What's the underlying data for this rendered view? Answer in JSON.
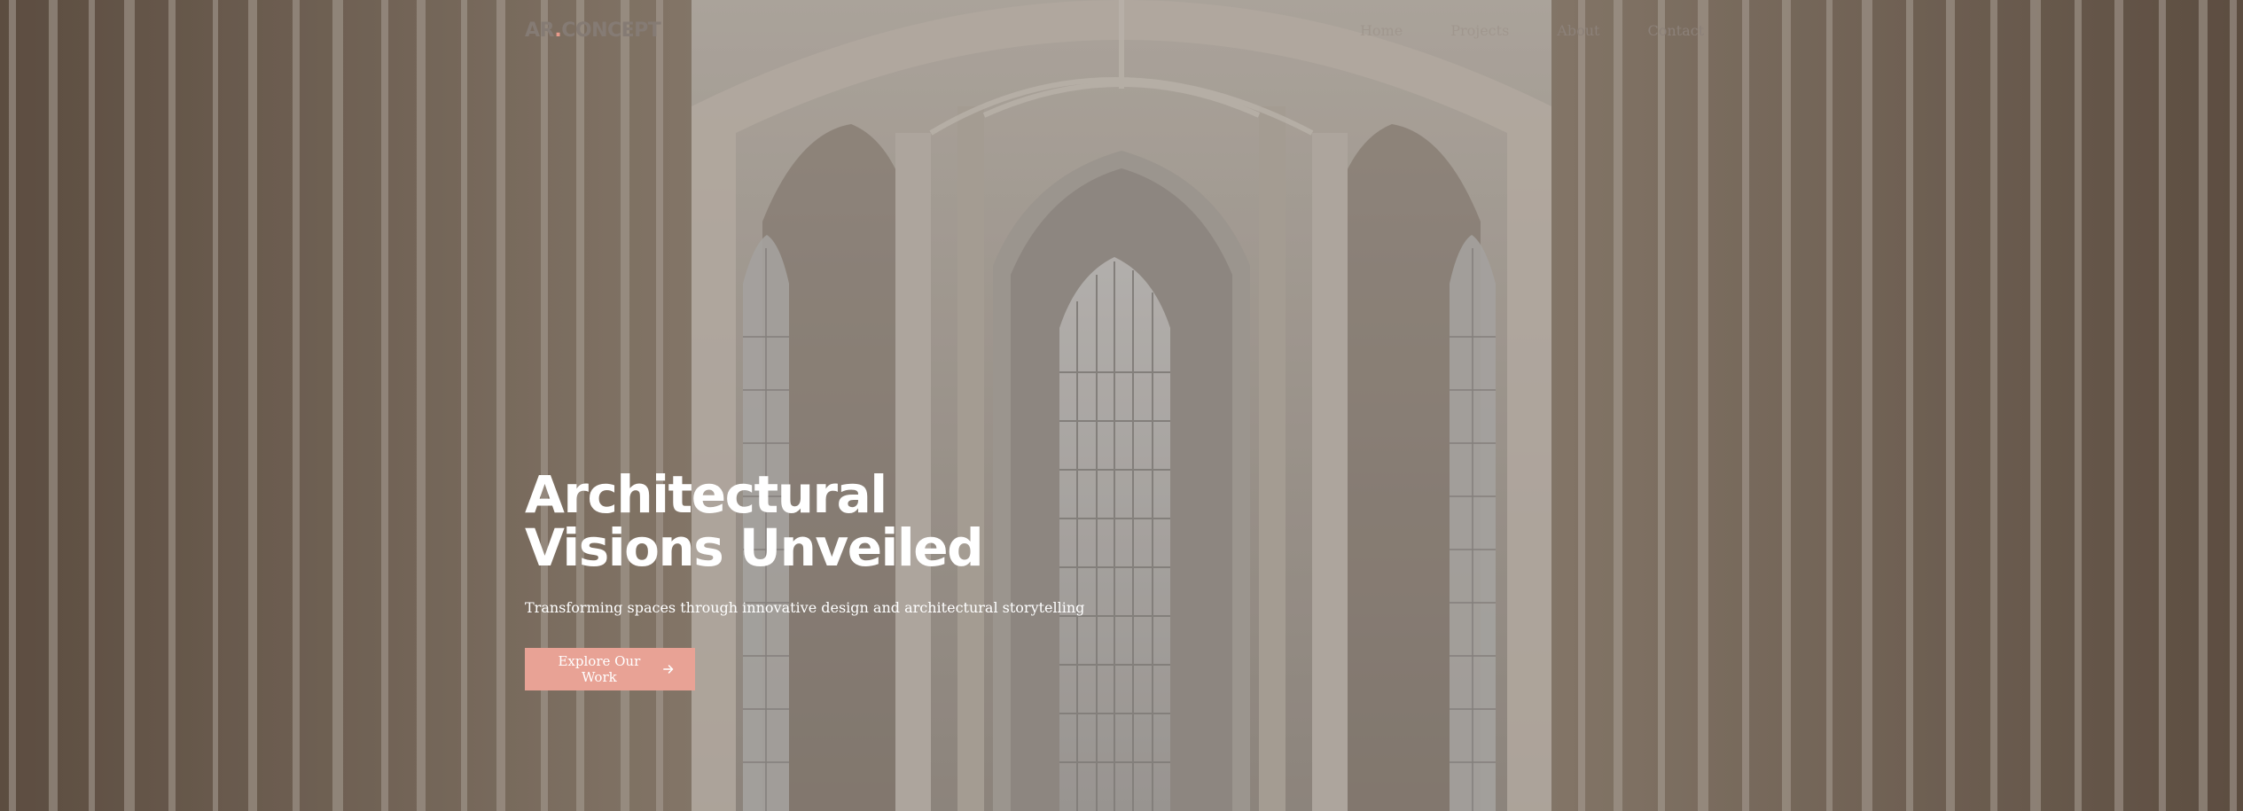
{
  "brand": {
    "logo_part1": "AR",
    "logo_dot": ".",
    "logo_part2": "CONCEPT",
    "accent_color": "#e8a295"
  },
  "nav": {
    "items": [
      {
        "label": "Home"
      },
      {
        "label": "Projects"
      },
      {
        "label": "About"
      },
      {
        "label": "Contact"
      }
    ]
  },
  "hero": {
    "title_line1": "Architectural",
    "title_line2": "Visions Unveiled",
    "subtitle": "Transforming spaces through innovative design and architectural storytelling",
    "cta_label": "Explore Our Work",
    "cta_icon": "arrow-right-icon",
    "background": "cathedral-interior-image"
  }
}
